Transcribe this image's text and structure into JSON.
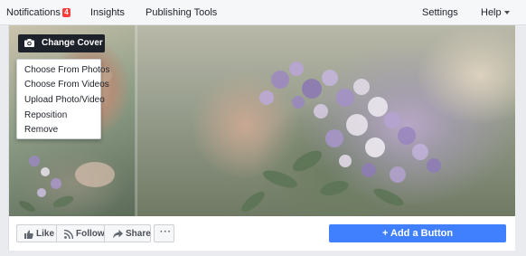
{
  "topnav": {
    "notifications": "Notifications",
    "notifications_count": "4",
    "insights": "Insights",
    "publishing_tools": "Publishing Tools",
    "settings": "Settings",
    "help": "Help"
  },
  "cover": {
    "change_cover": "Change Cover",
    "menu": [
      "Choose From Photos",
      "Choose From Videos",
      "Upload Photo/Video",
      "Reposition",
      "Remove"
    ]
  },
  "actions": {
    "like": "Like",
    "follow": "Follow",
    "share": "Share",
    "more": "···",
    "add_button": "+ Add a Button"
  },
  "colors": {
    "accent": "#4080ff",
    "badge": "#fa3e3e",
    "dark": "#1d2129"
  }
}
